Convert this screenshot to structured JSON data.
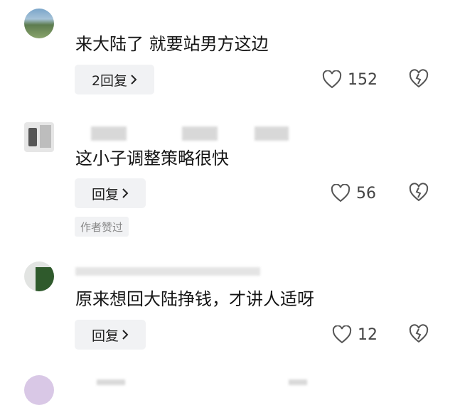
{
  "comments": [
    {
      "text": "来大陆了 就要站男方这边",
      "reply_label": "2回复",
      "likes": "152"
    },
    {
      "text": "这小子调整策略很快",
      "reply_label": "回复",
      "likes": "56",
      "author_tag": "作者赞过"
    },
    {
      "text": "原来想回大陆挣钱，才讲人适呀",
      "reply_label": "回复",
      "likes": "12"
    }
  ],
  "colors": {
    "button_bg": "#f1f2f4",
    "icon_stroke": "#555555"
  }
}
